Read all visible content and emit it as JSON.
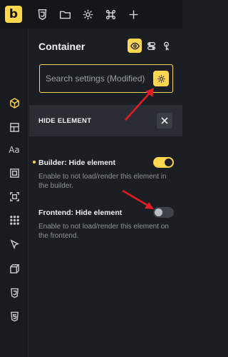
{
  "toolbar": {
    "logo": "b",
    "icons": [
      "css3-icon",
      "folder-icon",
      "gear-icon",
      "command-icon",
      "plus-icon"
    ]
  },
  "rail": {
    "icons": [
      "cube-icon",
      "layout-icon",
      "typography-icon",
      "frame-icon",
      "spacing-icon",
      "grid-dots-icon",
      "cursor-icon",
      "3d-box-icon",
      "css3-icon",
      "html5-icon"
    ],
    "typography_glyph": "Aa"
  },
  "panel": {
    "title": "Container",
    "modes": [
      "eye-icon",
      "toggles-icon",
      "pointer-icon"
    ],
    "search_placeholder": "Search settings (Modified)"
  },
  "section": {
    "title": "HIDE ELEMENT"
  },
  "settings": [
    {
      "label": "Builder: Hide element",
      "description": "Enable to not load/render this element in the builder.",
      "enabled": true,
      "modified": true
    },
    {
      "label": "Frontend: Hide element",
      "description": "Enable to not load/render this element on the frontend.",
      "enabled": false,
      "modified": false
    }
  ],
  "colors": {
    "accent": "#ffd64f",
    "background": "#1b1e22",
    "annotation_arrow": "#e31b23"
  }
}
